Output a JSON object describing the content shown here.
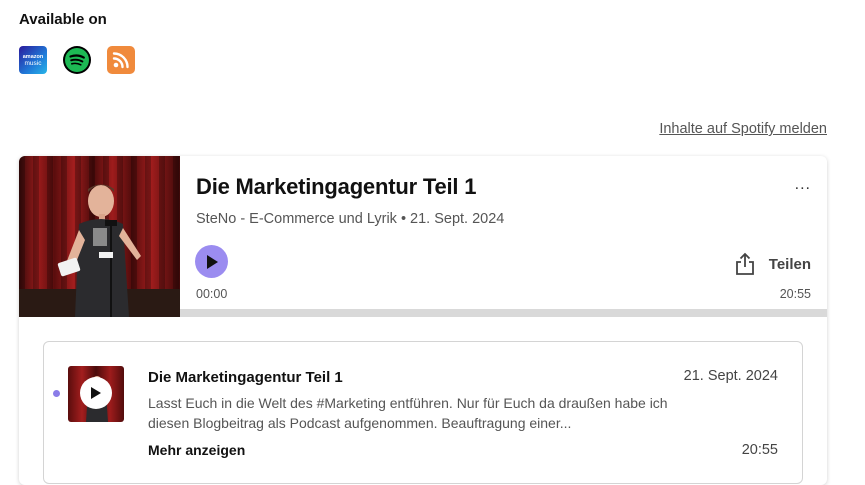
{
  "available": {
    "title": "Available on",
    "platforms": [
      {
        "name": "amazon-music",
        "logo_top": "amazon",
        "logo_bottom": "music",
        "icon": "amazon-music-icon"
      },
      {
        "name": "spotify",
        "icon": "spotify-icon",
        "color": "#1DB954"
      },
      {
        "name": "rss",
        "icon": "rss-icon",
        "color": "#F08A3C"
      }
    ]
  },
  "report_link": "Inhalte auf Spotify melden",
  "player": {
    "title": "Die Marketingagentur Teil 1",
    "meta": "SteNo - E-Commerce und Lyrik • 21. Sept. 2024",
    "more": "...",
    "share_label": "Teilen",
    "time_current": "00:00",
    "time_total": "20:55",
    "progress": 0,
    "accent": "#9B8CF0"
  },
  "episode": {
    "title": "Die Marketingagentur Teil 1",
    "date": "21. Sept. 2024",
    "description": "Lasst Euch in die Welt des #Marketing entführen. Nur für Euch da draußen habe ich diesen Blogbeitrag als Podcast aufgenommen. Beauftragung einer...",
    "more_label": "Mehr anzeigen",
    "duration": "20:55",
    "unplayed_dot_color": "#8A7CE8"
  }
}
